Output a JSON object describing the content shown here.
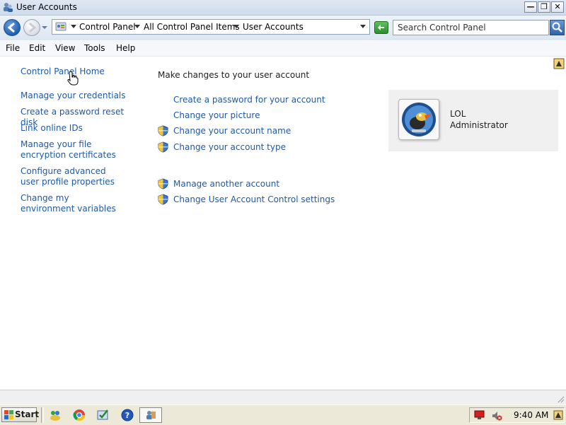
{
  "window": {
    "title": "User Accounts"
  },
  "address_bar": {
    "breadcrumbs": [
      "Control Panel",
      "All Control Panel Items",
      "User Accounts"
    ],
    "search_placeholder": "Search Control Panel"
  },
  "menu": {
    "items": [
      "File",
      "Edit",
      "View",
      "Tools",
      "Help"
    ]
  },
  "sidebar": {
    "home_link": "Control Panel Home",
    "links": [
      "Manage your credentials",
      "Create a password reset disk",
      "Link online IDs",
      "Manage your file encryption certificates",
      "Configure advanced user profile properties",
      "Change my environment variables"
    ]
  },
  "main": {
    "heading": "Make changes to your user account",
    "tasks": [
      {
        "label": "Create a password for your account",
        "shield": false
      },
      {
        "label": "Change your picture",
        "shield": false
      },
      {
        "label": "Change your account name",
        "shield": true
      },
      {
        "label": "Change your account type",
        "shield": true
      }
    ],
    "other_tasks": [
      {
        "label": "Manage another account",
        "shield": true
      },
      {
        "label": "Change User Account Control settings",
        "shield": true
      }
    ]
  },
  "account": {
    "name": "LOL",
    "role": "Administrator"
  },
  "taskbar": {
    "start_label": "Start",
    "clock": "9:40 AM"
  },
  "colors": {
    "link": "#1e59a8",
    "account_box_bg": "#f0f0f0",
    "taskbar_bg": "#ece9d8"
  }
}
